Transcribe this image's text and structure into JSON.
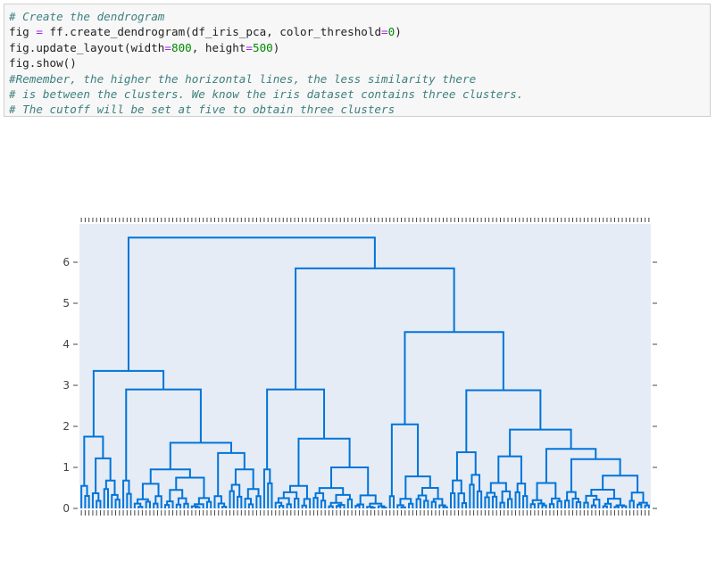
{
  "cell": {
    "lines": [
      {
        "parts": [
          {
            "t": "# Create the dendrogram",
            "k": "cm"
          }
        ]
      },
      {
        "parts": [
          {
            "t": "fig ",
            "k": ""
          },
          {
            "t": "=",
            "k": "op"
          },
          {
            "t": " ff.create_dendrogram(df_iris_pca, color_threshold",
            "k": ""
          },
          {
            "t": "=",
            "k": "op"
          },
          {
            "t": "0",
            "k": "num"
          },
          {
            "t": ")",
            "k": ""
          }
        ]
      },
      {
        "parts": [
          {
            "t": "fig.update_layout(width",
            "k": ""
          },
          {
            "t": "=",
            "k": "op"
          },
          {
            "t": "800",
            "k": "num"
          },
          {
            "t": ", height",
            "k": ""
          },
          {
            "t": "=",
            "k": "op"
          },
          {
            "t": "500",
            "k": "num"
          },
          {
            "t": ")",
            "k": ""
          }
        ]
      },
      {
        "parts": [
          {
            "t": "fig.show()",
            "k": ""
          }
        ]
      },
      {
        "parts": [
          {
            "t": "#Remember, the higher the horizontal lines, the less similarity there",
            "k": "cm"
          }
        ]
      },
      {
        "parts": [
          {
            "t": "# is between the clusters. We know the iris dataset contains three clusters.",
            "k": "cm"
          }
        ]
      },
      {
        "parts": [
          {
            "t": "# The cutoff will be set at five to obtain three clusters",
            "k": "cm"
          }
        ]
      }
    ]
  },
  "chart_data": {
    "type": "dendrogram",
    "line_color": "#0074d9",
    "plot_bg": "#e5ecf6",
    "ylim": [
      0,
      6.9
    ],
    "yticks": [
      "0",
      "1",
      "2",
      "3",
      "4",
      "5",
      "6"
    ],
    "leaf_count": 150,
    "tree": {
      "h": 6.6,
      "c": [
        {
          "h": 3.35,
          "c": [
            {
              "h": 1.75,
              "c": [
                {
                  "h": 0.55,
                  "n": 3
                },
                {
                  "h": 1.22,
                  "c": [
                    {
                      "h": 0.37,
                      "n": 3
                    },
                    {
                      "h": 0.68,
                      "n": 5
                    }
                  ]
                }
              ]
            },
            {
              "h": 2.9,
              "c": [
                {
                  "h": 0.68,
                  "n": 3
                },
                {
                  "h": 1.6,
                  "c": [
                    {
                      "h": 0.95,
                      "c": [
                        {
                          "h": 0.6,
                          "n": 8
                        },
                        {
                          "h": 0.75,
                          "n": 13
                        }
                      ]
                    },
                    {
                      "h": 1.35,
                      "c": [
                        {
                          "h": 0.3,
                          "n": 4
                        },
                        {
                          "h": 0.95,
                          "n": 9
                        }
                      ]
                    }
                  ]
                }
              ]
            }
          ]
        },
        {
          "h": 5.85,
          "c": [
            {
              "h": 2.9,
              "c": [
                {
                  "h": 0.95,
                  "n": 3
                },
                {
                  "h": 1.7,
                  "c": [
                    {
                      "h": 0.55,
                      "n": 10
                    },
                    {
                      "h": 1.0,
                      "n": 20
                    }
                  ]
                }
              ]
            },
            {
              "h": 4.3,
              "c": [
                {
                  "h": 2.05,
                  "c": [
                    {
                      "h": 0.3,
                      "n": 2
                    },
                    {
                      "h": 0.78,
                      "n": 14
                    }
                  ]
                },
                {
                  "h": 2.88,
                  "c": [
                    {
                      "h": 1.37,
                      "n": 9
                    },
                    {
                      "h": 1.92,
                      "c": [
                        {
                          "h": 1.27,
                          "n": 12
                        },
                        {
                          "h": 1.45,
                          "c": [
                            {
                              "h": 0.62,
                              "n": 9
                            },
                            {
                              "h": 1.2,
                              "c": [
                                {
                                  "h": 0.4,
                                  "n": 5
                                },
                                {
                                  "h": 0.8,
                                  "n": 18
                                }
                              ]
                            }
                          ]
                        }
                      ]
                    }
                  ]
                }
              ]
            }
          ]
        }
      ]
    }
  }
}
